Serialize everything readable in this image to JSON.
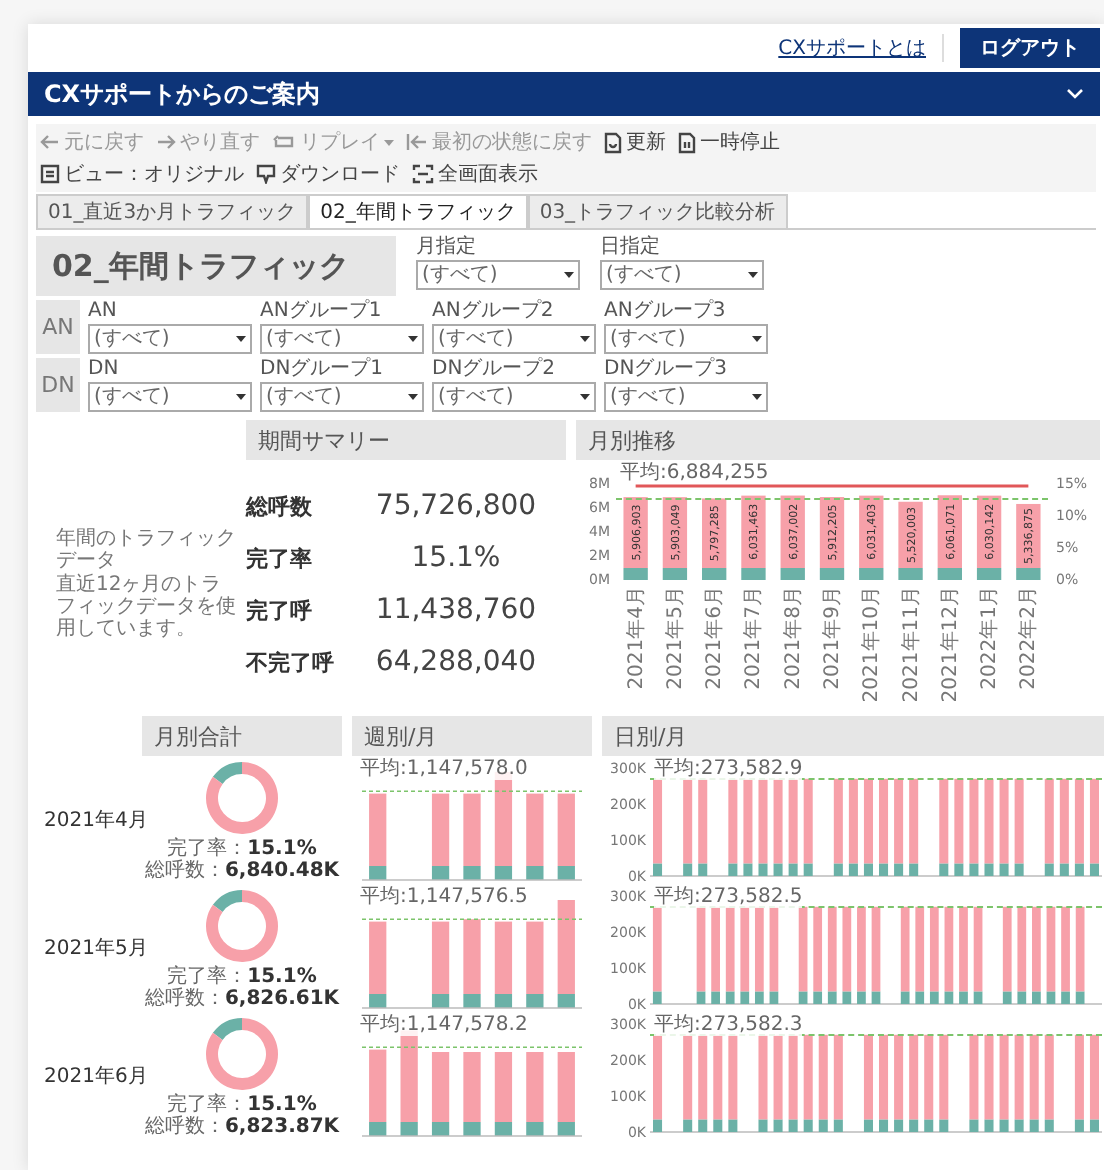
{
  "header": {
    "link": "CXサポートとは",
    "logout_button": "ログアウト"
  },
  "banner": {
    "title": "CXサポートからのご案内"
  },
  "toolbar": {
    "left": [
      {
        "kind": "undo",
        "label": "元に戻す",
        "disabled": true
      },
      {
        "kind": "redo",
        "label": "やり直す",
        "disabled": true
      },
      {
        "kind": "replay",
        "label": "リプレイ",
        "disabled": true,
        "has_menu": true
      },
      {
        "kind": "reset",
        "label": "最初の状態に戻す",
        "disabled": true
      },
      {
        "kind": "refresh",
        "label": "更新",
        "disabled": false
      },
      {
        "kind": "pause",
        "label": "一時停止",
        "disabled": false
      }
    ],
    "right": [
      {
        "kind": "view",
        "label": "ビュー：オリジナル",
        "disabled": false
      },
      {
        "kind": "download",
        "label": "ダウンロード",
        "disabled": false
      },
      {
        "kind": "fullscreen",
        "label": "全画面表示",
        "disabled": false
      }
    ]
  },
  "tabs": [
    {
      "label": "01_直近3か月トラフィック",
      "selected": false
    },
    {
      "label": "02_年間トラフィック",
      "selected": true
    },
    {
      "label": "03_トラフィック比較分析",
      "selected": false
    }
  ],
  "page_title": "02_年間トラフィック",
  "date_filters": [
    {
      "label": "月指定",
      "value": "(すべて)"
    },
    {
      "label": "日指定",
      "value": "(すべて)"
    }
  ],
  "filter_groups": [
    {
      "badge": "AN",
      "filters": [
        {
          "label": "AN",
          "value": "(すべて)"
        },
        {
          "label": "ANグループ1",
          "value": "(すべて)"
        },
        {
          "label": "ANグループ2",
          "value": "(すべて)"
        },
        {
          "label": "ANグループ3",
          "value": "(すべて)"
        }
      ]
    },
    {
      "badge": "DN",
      "filters": [
        {
          "label": "DN",
          "value": "(すべて)"
        },
        {
          "label": "DNグループ1",
          "value": "(すべて)"
        },
        {
          "label": "DNグループ2",
          "value": "(すべて)"
        },
        {
          "label": "DNグループ3",
          "value": "(すべて)"
        }
      ]
    }
  ],
  "summary": {
    "description": [
      "年間のトラフィックデータ",
      "直近12ヶ月のトラフィックデータを使用しています。"
    ],
    "title": "期間サマリー",
    "rows": [
      {
        "label": "総呼数",
        "value": "75,726,800"
      },
      {
        "label": "完了率",
        "value": "15.1%"
      },
      {
        "label": "完了呼",
        "value": "11,438,760"
      },
      {
        "label": "不完了呼",
        "value": "64,288,040"
      }
    ]
  },
  "monthly_trend": {
    "title": "月別推移",
    "average_label": "平均:6,884,255",
    "rate_axis_labels": [
      "15%",
      "10%",
      "5%",
      "0%"
    ],
    "chart_data": {
      "type": "bar",
      "stacked": true,
      "categories": [
        "2021年4月",
        "2021年5月",
        "2021年6月",
        "2021年7月",
        "2021年8月",
        "2021年9月",
        "2021年10月",
        "2021年11月",
        "2021年12月",
        "2022年1月",
        "2022年2月"
      ],
      "ylim": [
        0,
        8000000
      ],
      "yticks": [
        {
          "value": 0,
          "label": "0M"
        },
        {
          "value": 2000000,
          "label": "2M"
        },
        {
          "value": 4000000,
          "label": "4M"
        },
        {
          "value": 6000000,
          "label": "6M"
        },
        {
          "value": 8000000,
          "label": "8M"
        }
      ],
      "series": [
        {
          "color": "#6bb1a7",
          "values": [
            1000000,
            1000000,
            1000000,
            1000000,
            1000000,
            1000000,
            1000000,
            1000000,
            1000000,
            1000000,
            1000000
          ]
        },
        {
          "color": "#f7a0a9",
          "values": [
            5906903,
            5903049,
            5797285,
            6031463,
            6037002,
            5912205,
            6031403,
            5520003,
            6061071,
            6030142,
            5336875
          ],
          "value_labels": [
            "5,906,903",
            "5,903,049",
            "5,797,285",
            "6,031,463",
            "6,037,002",
            "5,912,205",
            "6,031,403",
            "5,520,003",
            "6,061,071",
            "6,030,142",
            "5,336,875"
          ]
        }
      ]
    }
  },
  "detail": {
    "headers": [
      "月別合計",
      "週別/月",
      "日別/月"
    ],
    "rows": [
      {
        "month": "2021年4月",
        "total": {
          "rate": "完了率：**15.1%**",
          "calls": "総呼数：**6,840.48K**",
          "chart_data": {
            "type": "donut",
            "values": [
              15,
              85
            ]
          }
        },
        "weekly": {
          "average_label": "平均:1,147,578.0"
        },
        "daily": {
          "average_label": "平均:273,582.9",
          "chart_data": {
            "type": "bar",
            "stacked": true,
            "ylim": [
              0,
              300000
            ],
            "yticks": [
              {
                "value": 0,
                "label": "0K"
              },
              {
                "value": 100000,
                "label": "100K"
              },
              {
                "value": 200000,
                "label": "200K"
              },
              {
                "value": 300000,
                "label": "300K"
              }
            ],
            "series": [
              {
                "color": "#6bb1a7",
                "values": [
                  35000,
                  0,
                  35000,
                  35000,
                  0,
                  35000,
                  35000,
                  35000,
                  35000,
                  35000,
                  35000,
                  0,
                  35000,
                  35000,
                  35000,
                  35000,
                  35000,
                  35000,
                  0,
                  35000,
                  35000,
                  35000,
                  35000,
                  35000,
                  35000,
                  0,
                  35000,
                  35000,
                  35000,
                  35000
                ]
              },
              {
                "color": "#f7a0a9",
                "values": [
                  235000,
                  0,
                  235000,
                  235000,
                  0,
                  235000,
                  235000,
                  235000,
                  235000,
                  235000,
                  235000,
                  0,
                  235000,
                  235000,
                  235000,
                  235000,
                  235000,
                  235000,
                  0,
                  235000,
                  235000,
                  235000,
                  235000,
                  235000,
                  235000,
                  0,
                  235000,
                  235000,
                  235000,
                  235000
                ]
              }
            ]
          }
        }
      },
      {
        "month": "2021年5月",
        "total": {
          "rate": "完了率：**15.1%**",
          "calls": "総呼数：**6,826.61K**",
          "chart_data": {
            "type": "donut",
            "values": [
              15,
              85
            ]
          }
        },
        "weekly": {
          "average_label": "平均:1,147,576.5"
        },
        "daily": {
          "average_label": "平均:273,582.5",
          "chart_data": {
            "type": "bar",
            "stacked": true,
            "ylim": [
              0,
              300000
            ],
            "yticks": [
              {
                "value": 0,
                "label": "0K"
              },
              {
                "value": 100000,
                "label": "100K"
              },
              {
                "value": 200000,
                "label": "200K"
              },
              {
                "value": 300000,
                "label": "300K"
              }
            ],
            "series": [
              {
                "color": "#6bb1a7",
                "values": [
                  35000,
                  0,
                  0,
                  35000,
                  35000,
                  35000,
                  35000,
                  35000,
                  35000,
                  0,
                  35000,
                  35000,
                  35000,
                  35000,
                  35000,
                  35000,
                  0,
                  35000,
                  35000,
                  35000,
                  35000,
                  35000,
                  35000,
                  0,
                  35000,
                  35000,
                  35000,
                  35000,
                  35000,
                  35000,
                  0
                ]
              },
              {
                "color": "#f7a0a9",
                "values": [
                  235000,
                  0,
                  0,
                  235000,
                  235000,
                  235000,
                  235000,
                  235000,
                  235000,
                  0,
                  235000,
                  235000,
                  235000,
                  235000,
                  235000,
                  235000,
                  0,
                  235000,
                  235000,
                  235000,
                  235000,
                  235000,
                  235000,
                  0,
                  235000,
                  235000,
                  235000,
                  235000,
                  235000,
                  235000,
                  0
                ]
              }
            ]
          }
        }
      },
      {
        "month": "2021年6月",
        "total": {
          "rate": "完了率：**15.1%**",
          "calls": "総呼数：**6,823.87K**",
          "chart_data": {
            "type": "donut",
            "values": [
              15,
              85
            ]
          }
        },
        "weekly": {
          "average_label": "平均:1,147,578.2"
        },
        "daily": {
          "average_label": "平均:273,582.3",
          "chart_data": {
            "type": "bar",
            "stacked": true,
            "ylim": [
              0,
              300000
            ],
            "yticks": [
              {
                "value": 0,
                "label": "0K"
              },
              {
                "value": 100000,
                "label": "100K"
              },
              {
                "value": 200000,
                "label": "200K"
              },
              {
                "value": 300000,
                "label": "300K"
              }
            ],
            "series": [
              {
                "color": "#6bb1a7",
                "values": [
                  35000,
                  0,
                  35000,
                  35000,
                  35000,
                  35000,
                  0,
                  35000,
                  35000,
                  35000,
                  35000,
                  35000,
                  35000,
                  0,
                  35000,
                  35000,
                  35000,
                  35000,
                  35000,
                  35000,
                  0,
                  35000,
                  35000,
                  35000,
                  35000,
                  35000,
                  35000,
                  0,
                  35000,
                  35000
                ]
              },
              {
                "color": "#f7a0a9",
                "values": [
                  235000,
                  0,
                  235000,
                  235000,
                  235000,
                  235000,
                  0,
                  235000,
                  235000,
                  235000,
                  235000,
                  235000,
                  235000,
                  0,
                  235000,
                  235000,
                  235000,
                  235000,
                  235000,
                  235000,
                  0,
                  235000,
                  235000,
                  235000,
                  235000,
                  235000,
                  235000,
                  0,
                  235000,
                  235000
                ]
              }
            ]
          }
        }
      }
    ]
  }
}
